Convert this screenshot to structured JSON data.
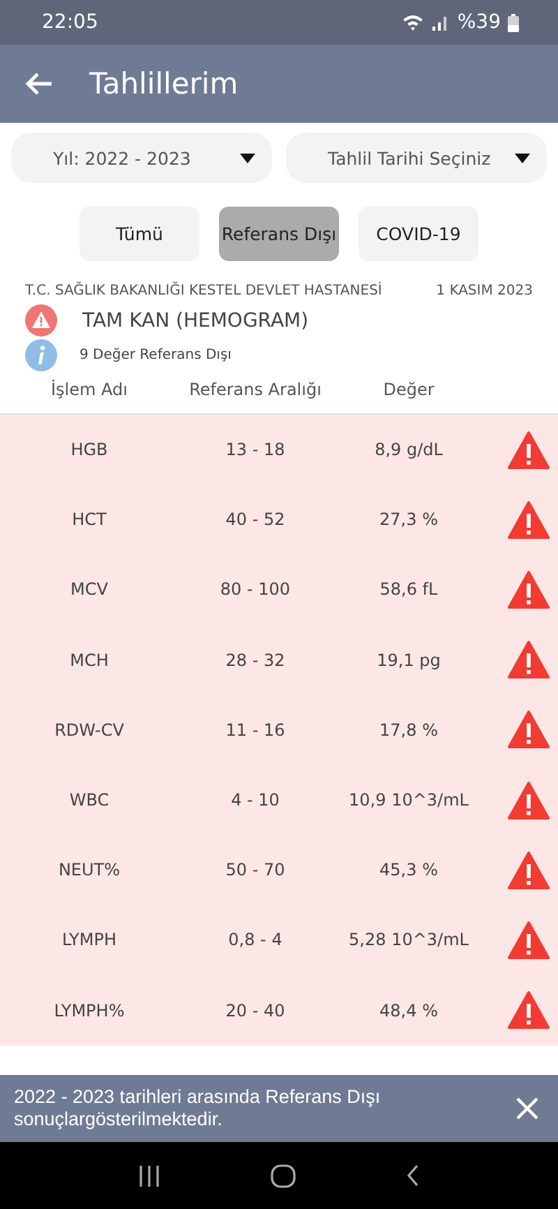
{
  "status_bar": {
    "time": "22:05",
    "battery": "%39"
  },
  "header": {
    "title": "Tahlillerim"
  },
  "filters": [
    {
      "label": "Yıl: 2022 - 2023"
    },
    {
      "label": "Tahlil Tarihi Seçiniz"
    }
  ],
  "tabs": [
    {
      "label": "Tümü",
      "selected": false
    },
    {
      "label": "Referans Dışı",
      "selected": true
    },
    {
      "label": "COVID-19",
      "selected": false
    }
  ],
  "report": {
    "hospital": "T.C. SAĞLIK BAKANLIĞI KESTEL DEVLET HASTANESİ",
    "date": "1 KASIM 2023",
    "title": "TAM KAN (HEMOGRAM)",
    "summary": "9 Değer Referans Dışı",
    "columns": [
      "İşlem Adı",
      "Referans Aralığı",
      "Değer"
    ],
    "rows": [
      {
        "name": "HGB",
        "range": "13 - 18",
        "value": "8,9 g/dL",
        "out_of_range": true
      },
      {
        "name": "HCT",
        "range": "40 - 52",
        "value": "27,3 %",
        "out_of_range": true
      },
      {
        "name": "MCV",
        "range": "80 - 100",
        "value": "58,6 fL",
        "out_of_range": true
      },
      {
        "name": "MCH",
        "range": "28 - 32",
        "value": "19,1 pg",
        "out_of_range": true
      },
      {
        "name": "RDW-CV",
        "range": "11 - 16",
        "value": "17,8 %",
        "out_of_range": true
      },
      {
        "name": "WBC",
        "range": "4 - 10",
        "value": "10,9 10^3/mL",
        "out_of_range": true
      },
      {
        "name": "NEUT%",
        "range": "50 - 70",
        "value": "45,3 %",
        "out_of_range": true
      },
      {
        "name": "LYMPH",
        "range": "0,8 - 4",
        "value": "5,28 10^3/mL",
        "out_of_range": true
      },
      {
        "name": "LYMPH%",
        "range": "20 - 40",
        "value": "48,4 %",
        "out_of_range": true
      }
    ]
  },
  "snackbar": {
    "message": "2022 - 2023 tarihleri arasında Referans Dışı sonuçlargösterilmektedir."
  }
}
